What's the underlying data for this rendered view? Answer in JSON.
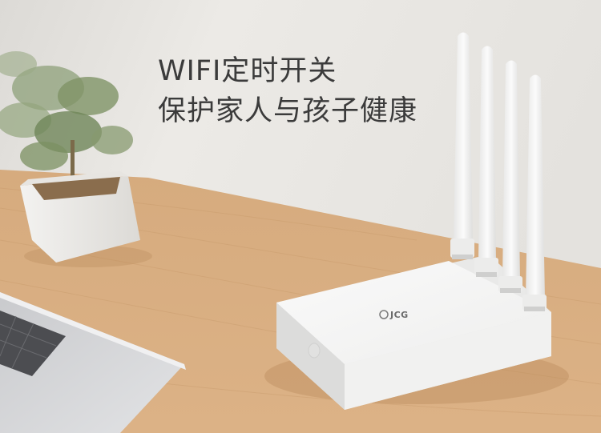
{
  "headline": {
    "line1": "WIFI定时开关",
    "line2": "保护家人与孩子健康"
  },
  "router": {
    "brand": "JCG",
    "antenna_count": 4
  },
  "colors": {
    "wall": "#ebe9e5",
    "desk": "#d9ae7f",
    "router_body": "#f7f7f6",
    "headline_text": "#3b3b3b"
  }
}
